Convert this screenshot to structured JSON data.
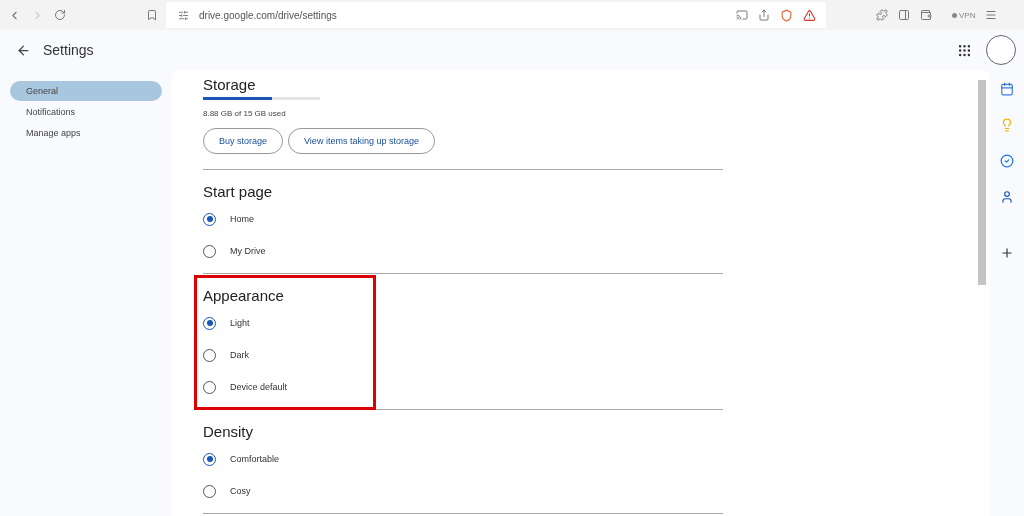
{
  "browser": {
    "url": "drive.google.com/drive/settings",
    "vpn_label": "VPN"
  },
  "header": {
    "title": "Settings"
  },
  "nav": [
    {
      "label": "General",
      "selected": true
    },
    {
      "label": "Notifications",
      "selected": false
    },
    {
      "label": "Manage apps",
      "selected": false
    }
  ],
  "storage": {
    "title": "Storage",
    "level": 0.59,
    "usage": "8.88 GB of 15 GB used",
    "buttons": [
      "Buy storage",
      "View items taking up storage"
    ]
  },
  "sections": [
    {
      "title": "Start page",
      "highlighted": false,
      "options": [
        {
          "label": "Home",
          "selected": true
        },
        {
          "label": "My Drive",
          "selected": false
        }
      ]
    },
    {
      "title": "Appearance",
      "highlighted": true,
      "options": [
        {
          "label": "Light",
          "selected": true
        },
        {
          "label": "Dark",
          "selected": false
        },
        {
          "label": "Device default",
          "selected": false
        }
      ]
    },
    {
      "title": "Density",
      "highlighted": false,
      "options": [
        {
          "label": "Comfortable",
          "selected": true
        },
        {
          "label": "Cosy",
          "selected": false
        }
      ]
    }
  ]
}
